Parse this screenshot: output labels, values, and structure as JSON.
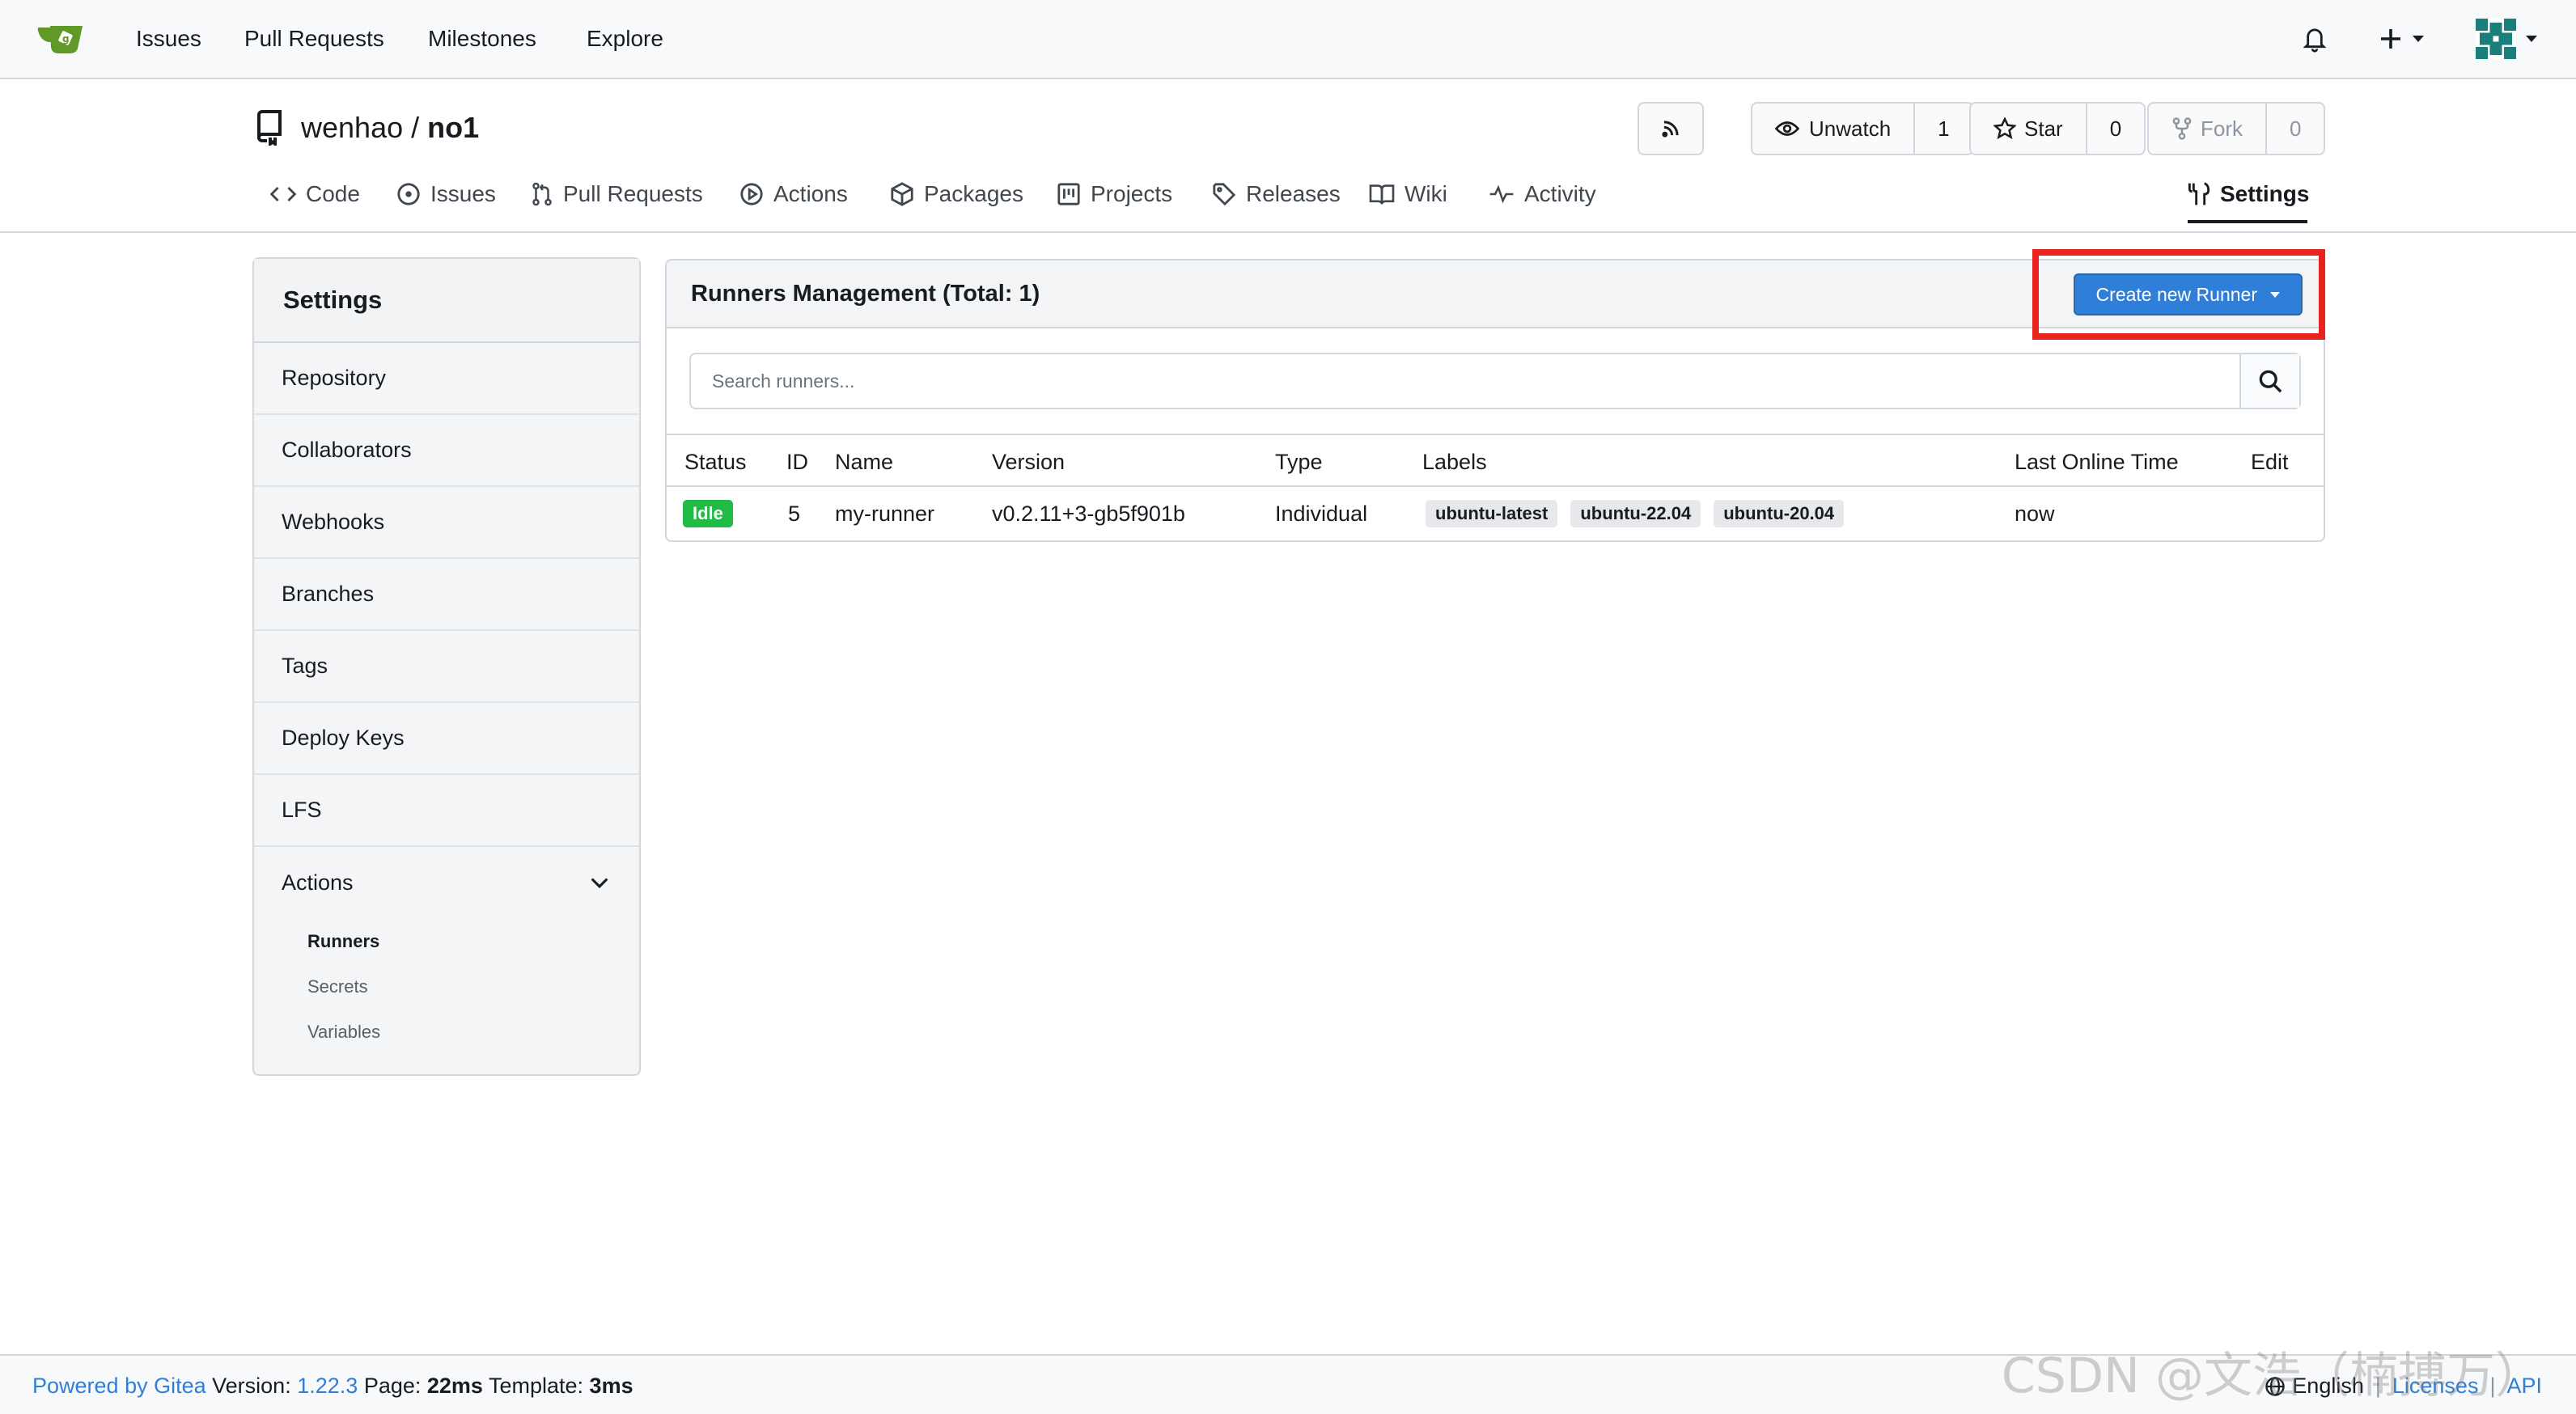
{
  "navbar": {
    "links": [
      "Issues",
      "Pull Requests",
      "Milestones",
      "Explore"
    ]
  },
  "repo": {
    "owner": "wenhao",
    "separator": "/",
    "name": "no1",
    "watch_label": "Unwatch",
    "watch_count": "1",
    "star_label": "Star",
    "star_count": "0",
    "fork_label": "Fork",
    "fork_count": "0",
    "tabs": [
      "Code",
      "Issues",
      "Pull Requests",
      "Actions",
      "Packages",
      "Projects",
      "Releases",
      "Wiki",
      "Activity"
    ],
    "settings_tab": "Settings"
  },
  "sidebar": {
    "title": "Settings",
    "items": [
      "Repository",
      "Collaborators",
      "Webhooks",
      "Branches",
      "Tags",
      "Deploy Keys",
      "LFS"
    ],
    "actions_label": "Actions",
    "sub_items": [
      "Runners",
      "Secrets",
      "Variables"
    ]
  },
  "panel": {
    "title": "Runners Management (Total: 1)",
    "create_button": "Create new Runner",
    "search_placeholder": "Search runners...",
    "columns": [
      "Status",
      "ID",
      "Name",
      "Version",
      "Type",
      "Labels",
      "Last Online Time",
      "Edit"
    ],
    "rows": [
      {
        "status": "Idle",
        "id": "5",
        "name": "my-runner",
        "version": "v0.2.11+3-gb5f901b",
        "type": "Individual",
        "labels": [
          "ubuntu-latest",
          "ubuntu-22.04",
          "ubuntu-20.04"
        ],
        "last_online": "now"
      }
    ]
  },
  "footer": {
    "powered_by": "Powered by Gitea",
    "version_label": "Version:",
    "version": "1.22.3",
    "page_label": "Page:",
    "page_time": "22ms",
    "template_label": "Template:",
    "template_time": "3ms",
    "language": "English",
    "licenses": "Licenses",
    "api": "API"
  },
  "watermark": "CSDN @文浩（楠搏万）",
  "colors": {
    "primary": "#2f7ed8",
    "success": "#21ba45",
    "highlight": "#e8231f",
    "border": "#d0d7de"
  }
}
